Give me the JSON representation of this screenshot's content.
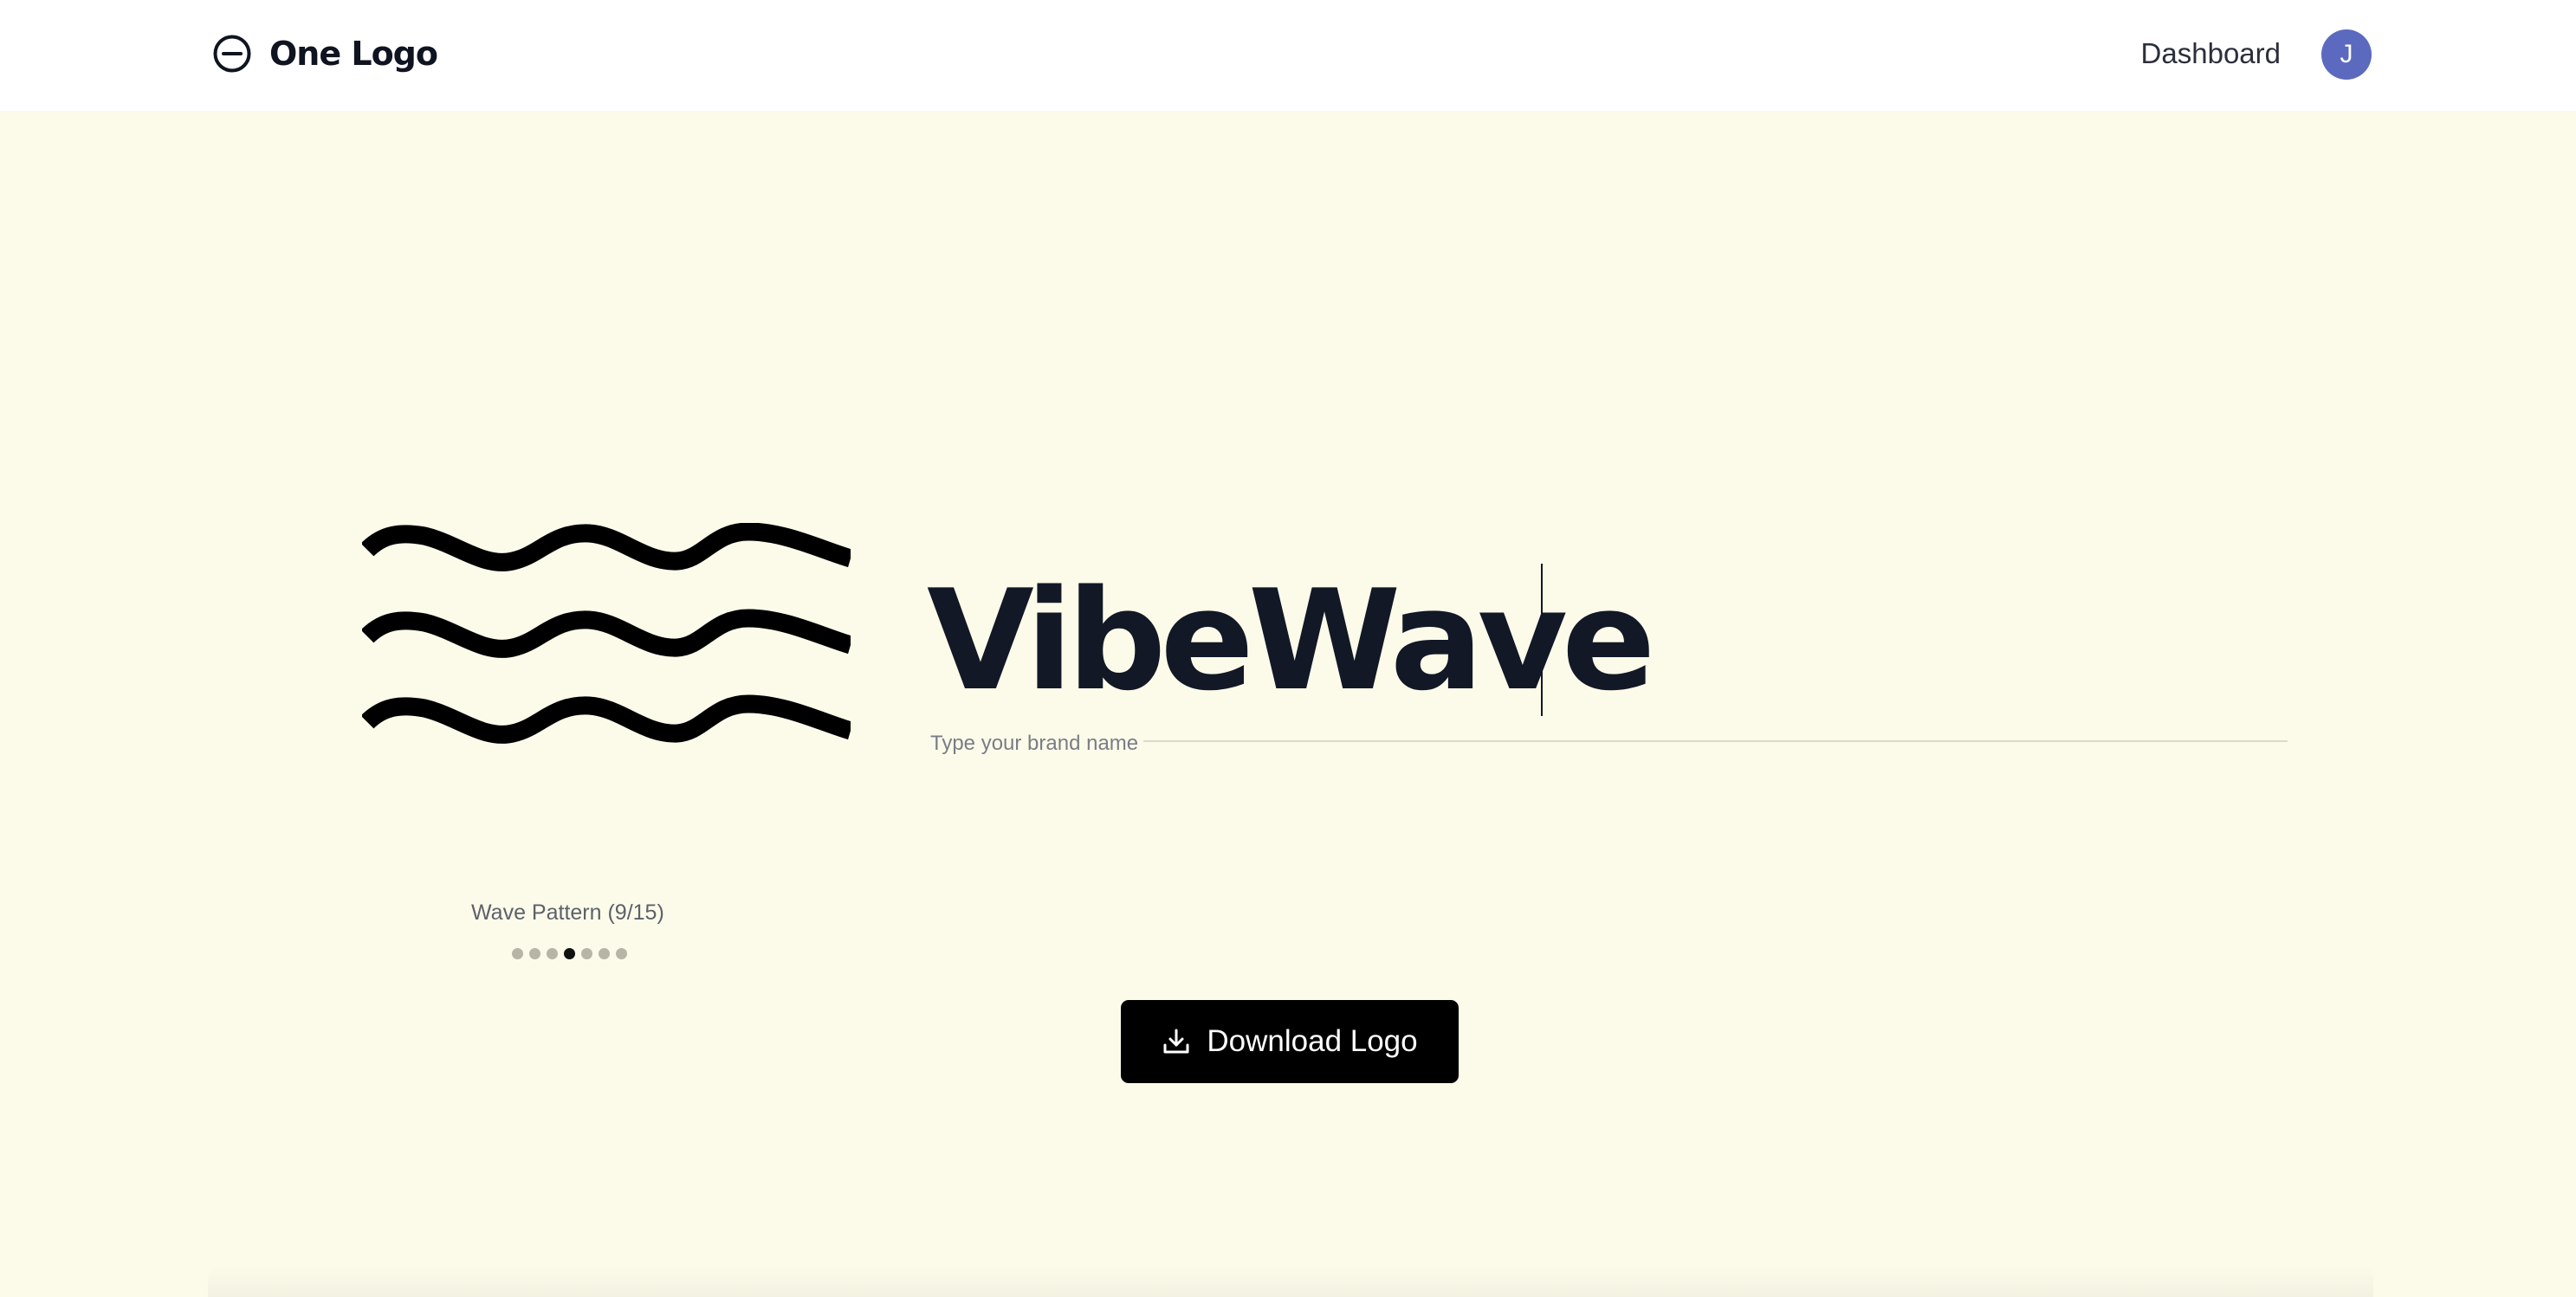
{
  "header": {
    "app_name": "One Logo",
    "logo_icon": "circle-minus-icon",
    "nav_dashboard": "Dashboard",
    "avatar_initial": "J"
  },
  "editor": {
    "brand_name": "VibeWave",
    "brand_placeholder": "Type your brand name",
    "symbol_icon": "wave-pattern-icon"
  },
  "pattern_selector": {
    "caption": "Wave Pattern (9/15)",
    "dots": [
      {
        "active": false
      },
      {
        "active": false
      },
      {
        "active": false
      },
      {
        "active": true
      },
      {
        "active": false
      },
      {
        "active": false
      },
      {
        "active": false
      }
    ]
  },
  "actions": {
    "download_label": "Download Logo",
    "download_icon": "download-icon"
  },
  "colors": {
    "background": "#fcfbea",
    "header_background": "#ffffff",
    "avatar": "#5b6abf",
    "button": "#000000",
    "text_primary": "#121826"
  }
}
